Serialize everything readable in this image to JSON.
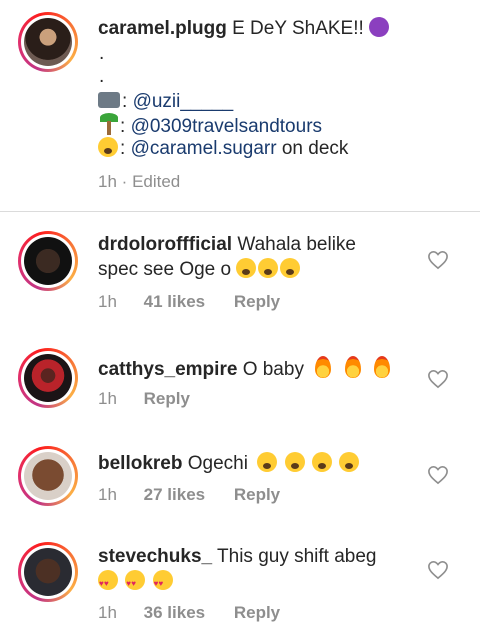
{
  "post": {
    "username": "caramel.plugg",
    "caption": "E DeY ShAKE!!",
    "dots": [
      ".",
      "."
    ],
    "credits": [
      {
        "icon": "camera-icon",
        "handle": "@uzii_____",
        "suffix": ""
      },
      {
        "icon": "palm-tree-icon",
        "handle": "@0309travelsandtours",
        "suffix": ""
      },
      {
        "icon": "grimace-emoji-icon",
        "handle": "@caramel.sugarr",
        "suffix": "on deck"
      }
    ],
    "time": "1h",
    "separator": "·",
    "edited": "Edited"
  },
  "comments": [
    {
      "username": "drdoloroffficial",
      "text_line1": "Wahala belike",
      "text_line2": "spec see Oge o",
      "time": "1h",
      "likes": "41 likes",
      "reply": "Reply"
    },
    {
      "username": "catthys_empire",
      "text": "O baby",
      "time": "1h",
      "reply": "Reply"
    },
    {
      "username": "bellokreb",
      "text": "Ogechi",
      "time": "1h",
      "likes": "27 likes",
      "reply": "Reply"
    },
    {
      "username": "stevechuks_",
      "text": "This guy shift abeg",
      "time": "1h",
      "likes": "36 likes",
      "reply": "Reply"
    }
  ],
  "colors": {
    "mention": "#1a3b6e",
    "meta": "#8e8e8e",
    "divider": "#dbdbdb"
  }
}
